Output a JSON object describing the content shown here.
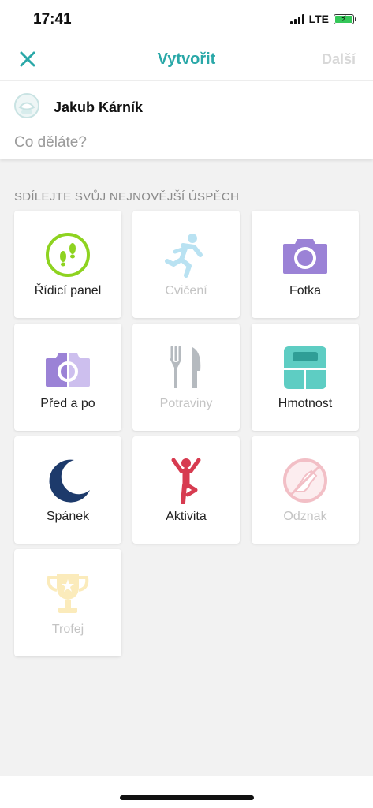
{
  "status_bar": {
    "time": "17:41",
    "network": "LTE"
  },
  "nav": {
    "title": "Vytvořit",
    "next_label": "Další",
    "close_icon": "close-icon"
  },
  "composer": {
    "user_name": "Jakub Kárník",
    "placeholder": "Co děláte?"
  },
  "section": {
    "header": "SDÍLEJTE SVŮJ NEJNOVĚJŠÍ ÚSPĚCH"
  },
  "tiles": [
    {
      "label": "Řídicí panel",
      "icon": "footsteps-icon",
      "enabled": true
    },
    {
      "label": "Cvičení",
      "icon": "running-icon",
      "enabled": false
    },
    {
      "label": "Fotka",
      "icon": "camera-icon",
      "enabled": true
    },
    {
      "label": "Před a po",
      "icon": "before-after-camera-icon",
      "enabled": true
    },
    {
      "label": "Potraviny",
      "icon": "fork-knife-icon",
      "enabled": false
    },
    {
      "label": "Hmotnost",
      "icon": "scale-icon",
      "enabled": true
    },
    {
      "label": "Spánek",
      "icon": "moon-icon",
      "enabled": true
    },
    {
      "label": "Aktivita",
      "icon": "activity-figure-icon",
      "enabled": true
    },
    {
      "label": "Odznak",
      "icon": "badge-icon",
      "enabled": false
    },
    {
      "label": "Trofej",
      "icon": "trophy-icon",
      "enabled": false
    }
  ],
  "colors": {
    "accent": "#2aa8a8",
    "dashboard_green": "#8ed320",
    "photo_purple": "#9b82d6",
    "scale_teal": "#5ecdc3",
    "sleep_navy": "#1d3a6b",
    "activity_red": "#d73b50",
    "exercise_blue": "#5bc4e0",
    "badge_red": "#e27583",
    "trophy_gold": "#f3d24f"
  }
}
